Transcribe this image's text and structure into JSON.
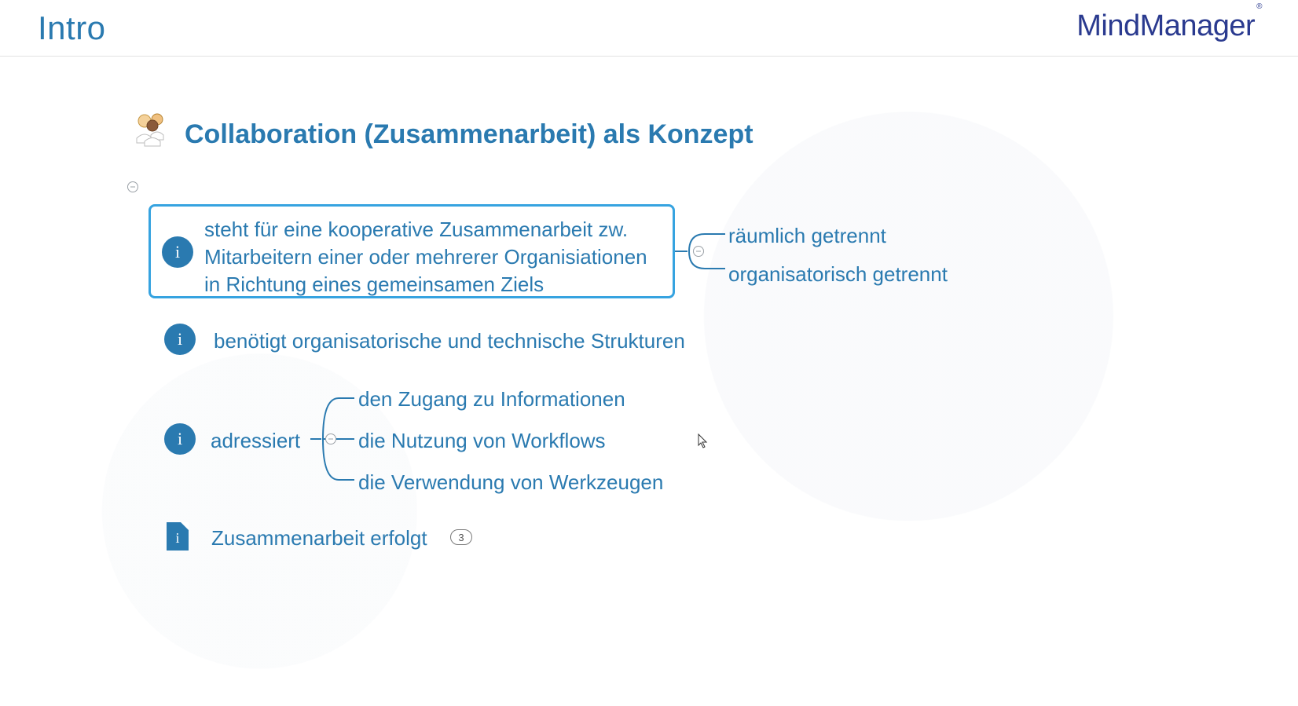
{
  "header": {
    "section": "Intro",
    "brand": "MindManager"
  },
  "map": {
    "title": "Collaboration  (Zusammenarbeit)  als Konzept",
    "nodes": [
      {
        "text": "steht für eine kooperative Zusammenarbeit zw. Mitarbeitern einer oder mehrerer Organisiationen in Richtung eines gemeinsamen Ziels",
        "selected": true,
        "icon": "info",
        "children": [
          "räumlich getrennt",
          "organisatorisch getrennt"
        ]
      },
      {
        "text": "benötigt organisatorische und technische Strukturen",
        "icon": "info"
      },
      {
        "text": "adressiert",
        "icon": "info",
        "children": [
          "den Zugang zu Informationen",
          "die Nutzung von Workflows",
          "die Verwendung von Werkzeugen"
        ]
      },
      {
        "text": "Zusammenarbeit erfolgt",
        "icon": "info-doc",
        "collapsed_count": "3"
      }
    ]
  }
}
